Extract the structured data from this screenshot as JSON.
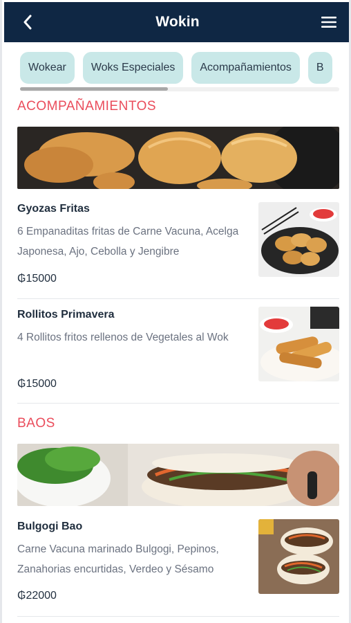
{
  "header": {
    "title": "Wokin",
    "back_icon": "chevron-left-icon",
    "menu_icon": "hamburger-menu-icon"
  },
  "categories": [
    "Wokear",
    "Woks Especiales",
    "Acompañamientos",
    "B"
  ],
  "sections": [
    {
      "title": "ACOMPAÑAMIENTOS",
      "items": [
        {
          "name": "Gyozas Fritas",
          "description": "6 Empanaditas fritas de Carne Vacuna, Acelga Japonesa, Ajo, Cebolla y Jengibre",
          "price": "₲15000"
        },
        {
          "name": "Rollitos Primavera",
          "description": "4 Rollitos fritos rellenos de Vegetales al Wok",
          "price": "₲15000"
        }
      ]
    },
    {
      "title": "BAOS",
      "items": [
        {
          "name": "Bulgogi Bao",
          "description": "Carne Vacuna marinado Bulgogi, Pepinos, Zanahorias encurtidas, Verdeo y Sésamo",
          "price": "₲22000"
        }
      ]
    }
  ],
  "colors": {
    "header_bg": "#0f2744",
    "accent": "#ea4c5b",
    "chip_bg": "#c9e8e8"
  }
}
